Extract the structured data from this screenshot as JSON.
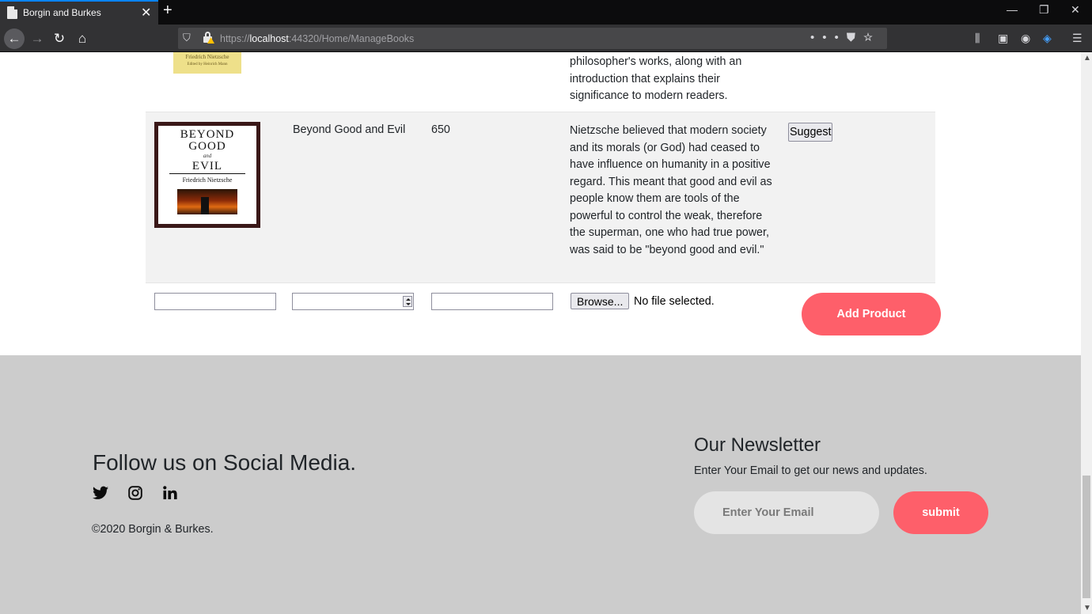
{
  "browser": {
    "tab_title": "Borgin and Burkes",
    "url_scheme": "https://",
    "url_host": "localhost",
    "url_rest": ":44320/Home/ManageBooks"
  },
  "previous_book": {
    "cover_title": "Friedrich Nietzsche",
    "cover_sub": "Edited by Heinrich Mann",
    "description": "philosopher's works, along with an introduction that explains their significance to modern readers."
  },
  "book": {
    "cover": {
      "line1": "BEYOND",
      "line2": "GOOD",
      "and": "and",
      "line3": "EVIL",
      "author": "Friedrich Nietzsche"
    },
    "title": "Beyond Good and Evil",
    "price": "650",
    "description": "Nietzsche believed that modern society and its morals (or God) had ceased to have influence on humanity in a positive regard. This meant that good and evil as people know them are tools of the powerful to control the weak, therefore the superman, one who had true power, was said to be \"beyond good and evil.\"",
    "suggest_label": "Suggest"
  },
  "add_form": {
    "browse_label": "Browse...",
    "no_file_text": "No file selected.",
    "add_label": "Add Product"
  },
  "footer": {
    "follow_title": "Follow us on Social Media.",
    "social_icons": [
      "twitter-icon",
      "instagram-icon",
      "linkedin-icon"
    ],
    "copyright": "©2020 Borgin & Burkes.",
    "newsletter_title": "Our Newsletter",
    "newsletter_sub": "Enter Your Email to get our news and updates.",
    "email_placeholder": "Enter Your Email",
    "submit_label": "submit"
  },
  "colors": {
    "accent": "#fe5f6a",
    "footer_bg": "#cccccc",
    "row_highlight": "#f2f2f2"
  }
}
